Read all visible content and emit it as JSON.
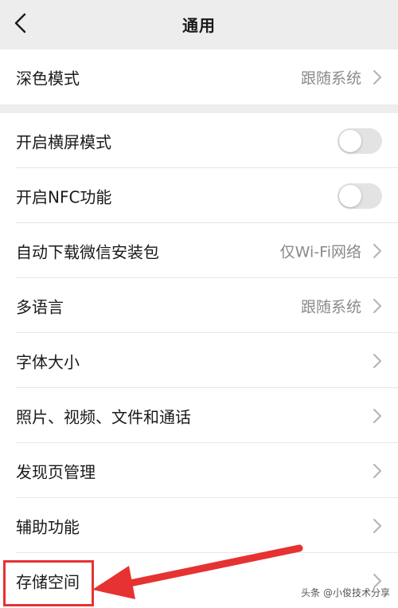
{
  "nav": {
    "back_icon": "chevron-left-icon",
    "title": "通用"
  },
  "colors": {
    "background": "#ededed",
    "surface": "#ffffff",
    "secondary_text": "#8a8a8a",
    "annotation_red": "#e63232"
  },
  "group1": {
    "items": [
      {
        "label": "深色模式",
        "value": "跟随系统",
        "chevron": true
      }
    ]
  },
  "group2": {
    "items": [
      {
        "label": "开启横屏模式",
        "toggle": false
      },
      {
        "label": "开启NFC功能",
        "toggle": false
      },
      {
        "label": "自动下载微信安装包",
        "value": "仅Wi-Fi网络",
        "chevron": true
      },
      {
        "label": "多语言",
        "value": "跟随系统",
        "chevron": true
      },
      {
        "label": "字体大小",
        "chevron": true
      },
      {
        "label": "照片、视频、文件和通话",
        "chevron": true
      },
      {
        "label": "发现页管理",
        "chevron": true
      },
      {
        "label": "辅助功能",
        "chevron": true
      },
      {
        "label": "存储空间",
        "chevron": true
      }
    ]
  },
  "annotation": {
    "highlighted_item": "存储空间",
    "arrow": "red-arrow"
  },
  "watermark": {
    "text": "头条 @小俊技术分享"
  }
}
